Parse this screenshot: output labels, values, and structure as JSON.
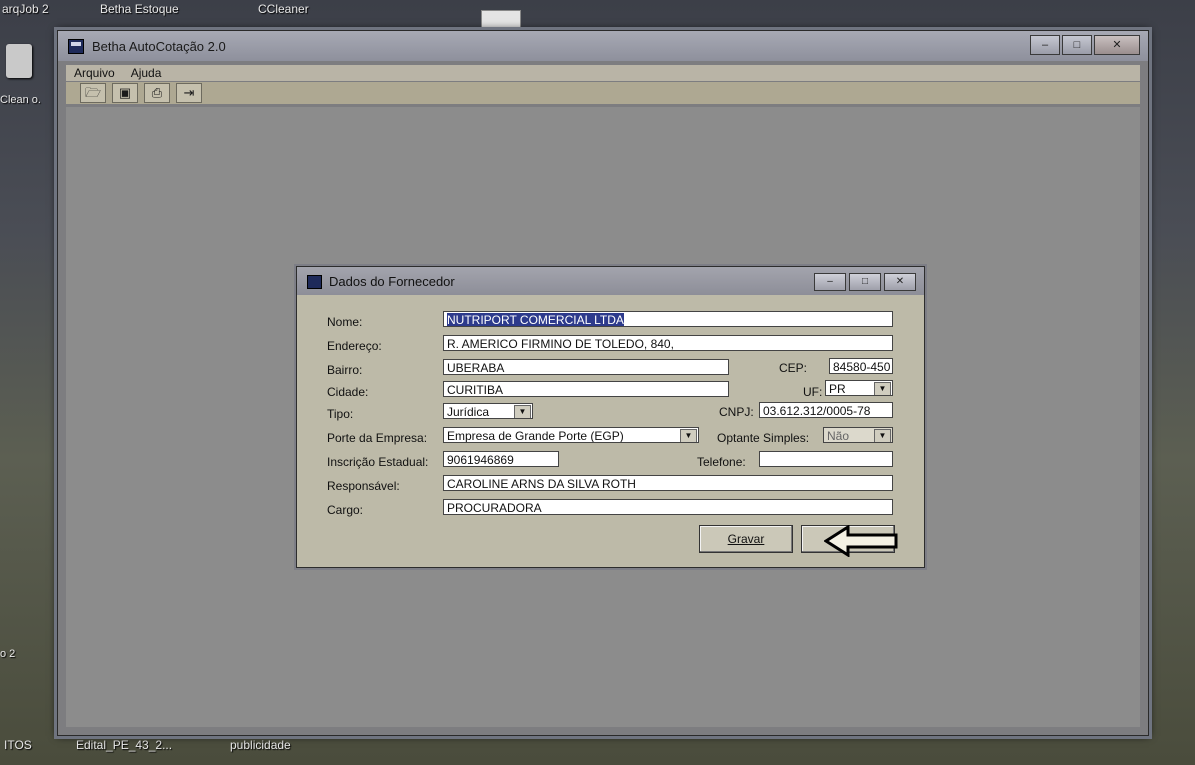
{
  "desktop": {
    "top_labels": [
      "arqJob 2",
      "Betha Estoque",
      "CCleaner"
    ],
    "side_labels": [
      "Clean o.",
      "o 2"
    ],
    "bottom_labels": [
      "ITOS",
      "Edital_PE_43_2...",
      "publicidade"
    ]
  },
  "main_window": {
    "title": "Betha AutoCotação 2.0",
    "menu": [
      "Arquivo",
      "Ajuda"
    ],
    "toolbar_icons": [
      "open-folder-icon",
      "save-icon",
      "print-icon",
      "exit-icon"
    ]
  },
  "dialog": {
    "title": "Dados do Fornecedor",
    "labels": {
      "nome": "Nome:",
      "endereco": "Endereço:",
      "bairro": "Bairro:",
      "cidade": "Cidade:",
      "tipo": "Tipo:",
      "porte": "Porte da Empresa:",
      "inscricao": "Inscrição Estadual:",
      "responsavel": "Responsável:",
      "cargo": "Cargo:",
      "cep": "CEP:",
      "uf": "UF:",
      "cnpj": "CNPJ:",
      "optante": "Optante Simples:",
      "telefone": "Telefone:"
    },
    "values": {
      "nome": "NUTRIPORT COMERCIAL LTDA",
      "endereco": "R. AMERICO FIRMINO DE TOLEDO, 840,",
      "bairro": "UBERABA",
      "cidade": "CURITIBA",
      "tipo": "Jurídica",
      "porte": "Empresa de Grande Porte (EGP)",
      "inscricao": "9061946869",
      "responsavel": "CAROLINE ARNS DA SILVA ROTH",
      "cargo": "PROCURADORA",
      "cep": "84580-450",
      "uf": "PR",
      "cnpj": "03.612.312/0005-78",
      "optante": "Não",
      "telefone": ""
    },
    "buttons": {
      "gravar": "Gravar"
    }
  }
}
